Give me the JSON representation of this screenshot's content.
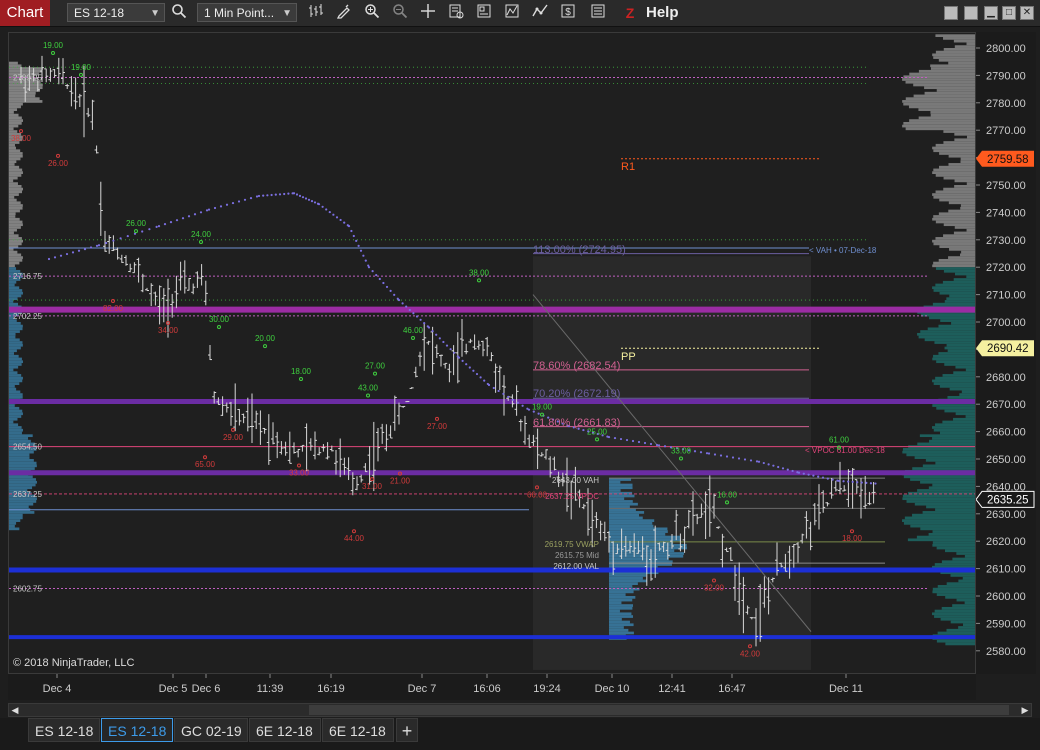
{
  "toolbar": {
    "app_label": "Chart",
    "instrument": "ES 12-18",
    "interval": "1 Min Point...",
    "help": "Help",
    "icons": [
      "search-icon",
      "bar-type-icon",
      "drawing-pencil-icon",
      "zoom-in-icon",
      "zoom-out-icon",
      "crosshair-icon",
      "data-box-icon",
      "templates-icon",
      "strategies-icon",
      "indicators-icon",
      "chart-trader-icon",
      "properties-icon",
      "z-icon"
    ]
  },
  "window_buttons": [
    "minimize-icon",
    "restore-icon",
    "maximize-icon",
    "close-icon"
  ],
  "chart": {
    "copyright": "© 2018 NinjaTrader, LLC",
    "price_ticks": [
      "2800.00",
      "2790.00",
      "2780.00",
      "2770.00",
      "2760.00",
      "2750.00",
      "2740.00",
      "2730.00",
      "2720.00",
      "2710.00",
      "2700.00",
      "2690.00",
      "2680.00",
      "2670.00",
      "2660.00",
      "2650.00",
      "2640.00",
      "2630.00",
      "2620.00",
      "2610.00",
      "2600.00",
      "2590.00",
      "2580.00"
    ],
    "price_markers": [
      {
        "label": "2759.58",
        "color": "#ff5a1e"
      },
      {
        "label": "2690.42",
        "color": "#f5f0a0"
      },
      {
        "label": "2635.25",
        "color": "#ffffff"
      }
    ],
    "time_ticks": [
      "Dec 4",
      "Dec 5",
      "Dec 6",
      "11:39",
      "16:19",
      "Dec 7",
      "16:06",
      "19:24",
      "Dec 10",
      "12:41",
      "16:47",
      "Dec 11"
    ],
    "level_labels_left": [
      "2789.25",
      "2716.75",
      "2702.25",
      "2654.50",
      "2637.25",
      "2602.75"
    ],
    "annotations": {
      "r1": "R1",
      "pp": "PP",
      "fib_113": "113.00% (2724.95)",
      "fib_786": "78.60% (2682.54)",
      "fib_702": "70.20% (2672.19)",
      "fib_618": "61.80% (2661.83)",
      "vah_prev": "< VAH • 07-Dec-18",
      "vpoc": "< VPOC 61.00 Dec-18",
      "vah": "2643.00 VAH",
      "vpoc_mid": "2637.25 VPOC",
      "vwap": "2619.75 VWAP",
      "mid": "2615.75 Mid",
      "val": "2612.00 VAL"
    },
    "bar_labels_green": [
      "19.00",
      "19.00",
      "26.00",
      "24.00",
      "30.00",
      "20.00",
      "18.00",
      "27.00",
      "43.00",
      "46.00",
      "38.00",
      "19.00",
      "25.00",
      "33.00",
      "16.00",
      "61.00"
    ],
    "bar_labels_red": [
      "38.00",
      "26.00",
      "82.00",
      "34.00",
      "65.00",
      "29.00",
      "33.00",
      "44.00",
      "31.00",
      "21.00",
      "27.00",
      "66.00",
      "32.00",
      "42.00",
      "18.00"
    ]
  },
  "tabs": [
    {
      "label": "ES 12-18",
      "active": false
    },
    {
      "label": "ES 12-18",
      "active": true
    },
    {
      "label": "GC 02-19",
      "active": false
    },
    {
      "label": "6E 12-18",
      "active": false
    },
    {
      "label": "6E 12-18",
      "active": false
    }
  ],
  "tab_add": "+"
}
